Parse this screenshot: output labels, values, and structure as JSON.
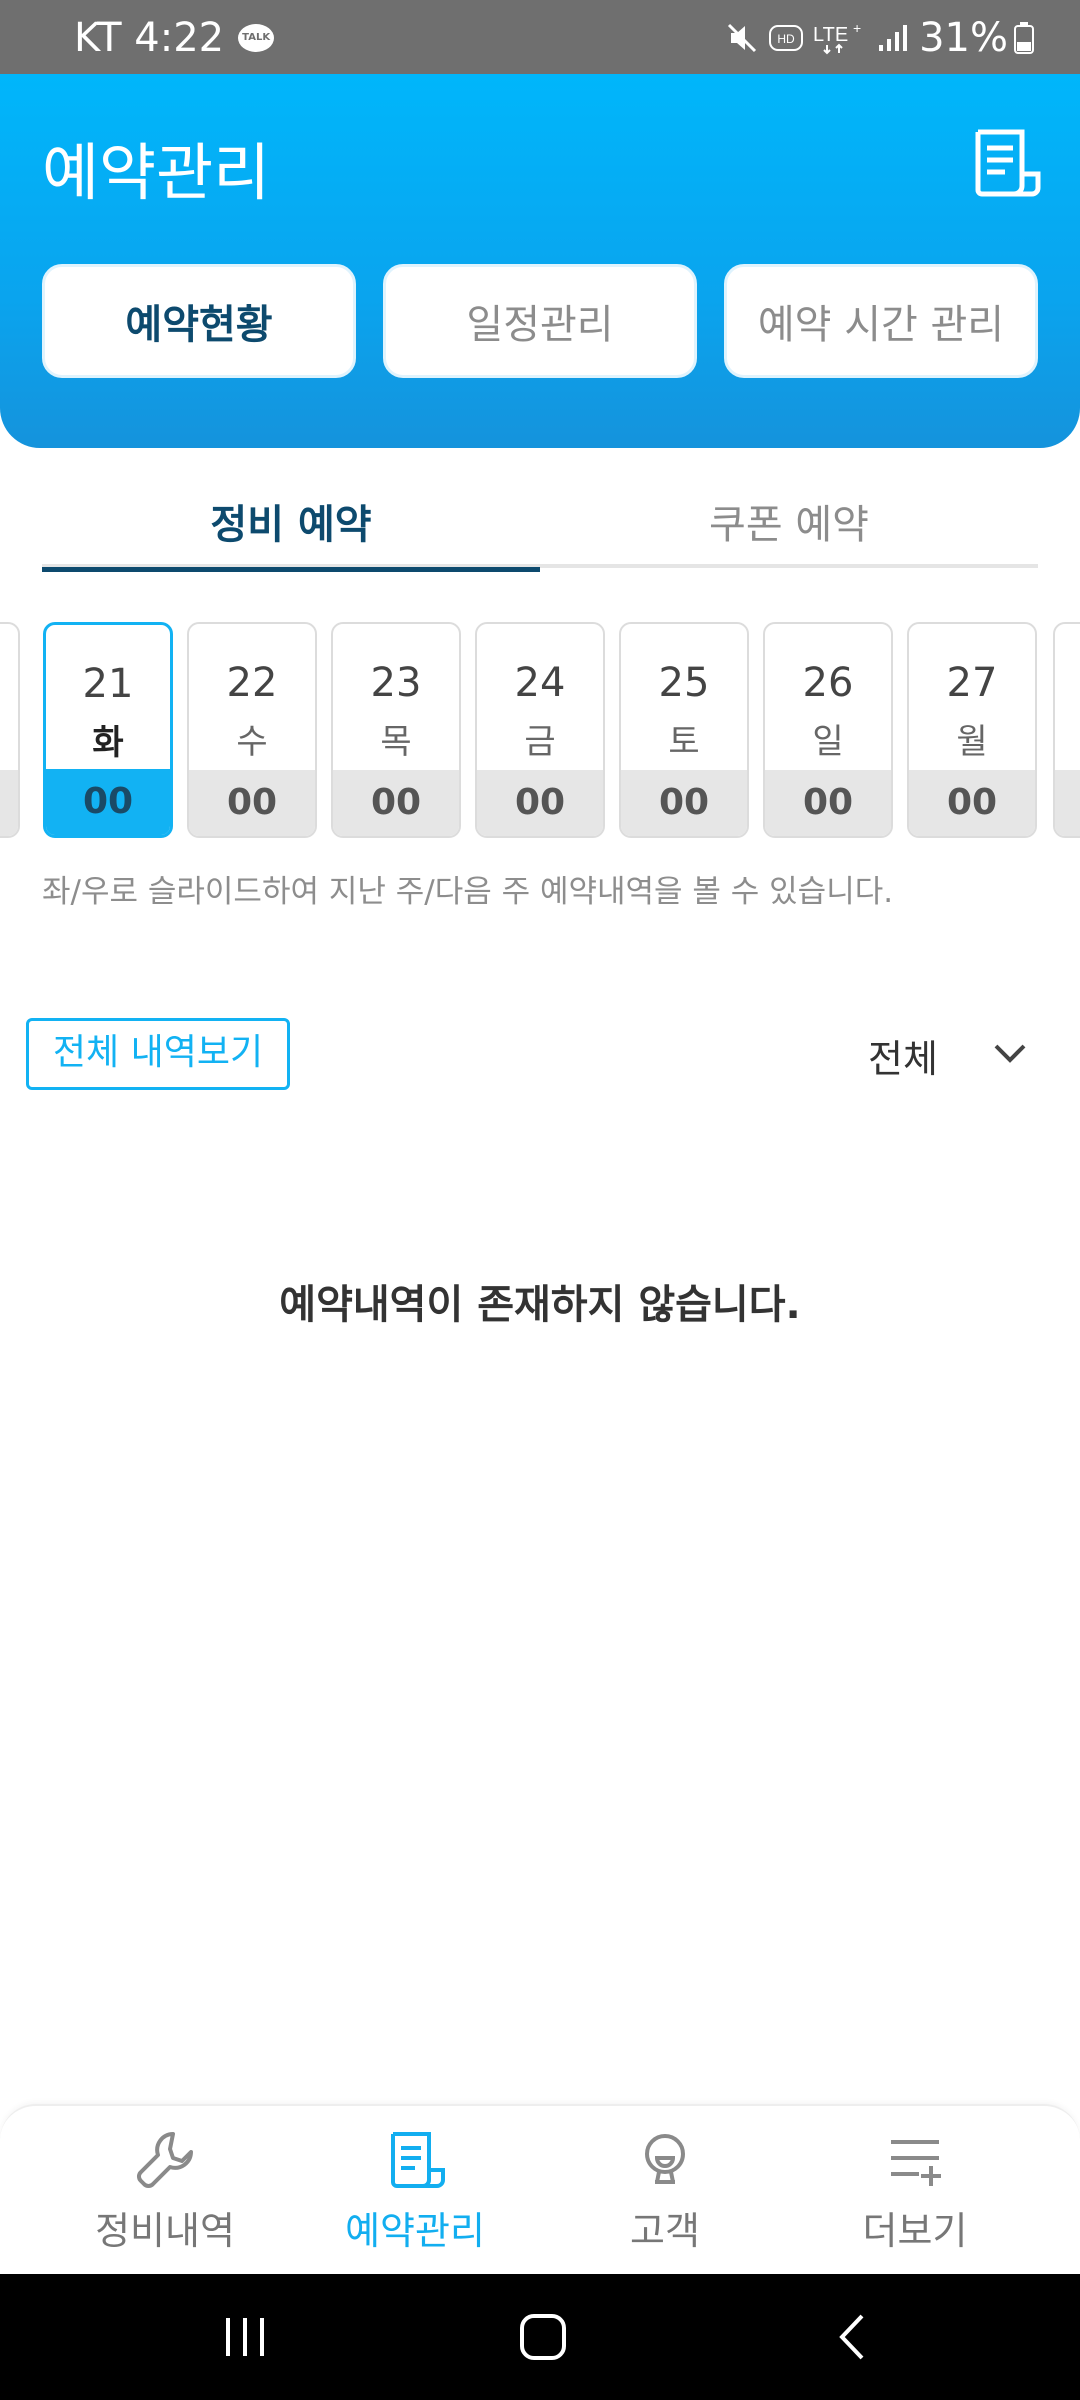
{
  "status_bar": {
    "carrier_time": "KT 4:22",
    "talk_badge": "TALK",
    "battery": "31%",
    "icons": [
      "talk-icon",
      "mute-icon",
      "hd-icon",
      "lte-icon",
      "signal-icon",
      "battery-icon"
    ]
  },
  "header": {
    "title": "예약관리",
    "doc_icon": "document-icon",
    "segments": [
      "예약현황",
      "일정관리",
      "예약 시간 관리"
    ]
  },
  "tabs": [
    "정비 예약",
    "쿠폰 예약"
  ],
  "dates": [
    {
      "day": "21",
      "weekday": "화",
      "count": "00"
    },
    {
      "day": "22",
      "weekday": "수",
      "count": "00"
    },
    {
      "day": "23",
      "weekday": "목",
      "count": "00"
    },
    {
      "day": "24",
      "weekday": "금",
      "count": "00"
    },
    {
      "day": "25",
      "weekday": "토",
      "count": "00"
    },
    {
      "day": "26",
      "weekday": "일",
      "count": "00"
    },
    {
      "day": "27",
      "weekday": "월",
      "count": "00"
    }
  ],
  "hint": "좌/우로 슬라이드하여 지난 주/다음 주 예약내역을 볼 수 있습니다.",
  "all_history_button": "전체 내역보기",
  "filter": {
    "selected": "전체"
  },
  "empty_message": "예약내역이 존재하지 않습니다.",
  "bottom_nav": [
    {
      "label": "정비내역",
      "icon": "wrench-icon"
    },
    {
      "label": "예약관리",
      "icon": "document-icon"
    },
    {
      "label": "고객",
      "icon": "customer-icon"
    },
    {
      "label": "더보기",
      "icon": "more-icon"
    }
  ],
  "colors": {
    "accent": "#12b2f3",
    "header_top": "#00b6fb",
    "dark_text": "#0d4a6e"
  }
}
